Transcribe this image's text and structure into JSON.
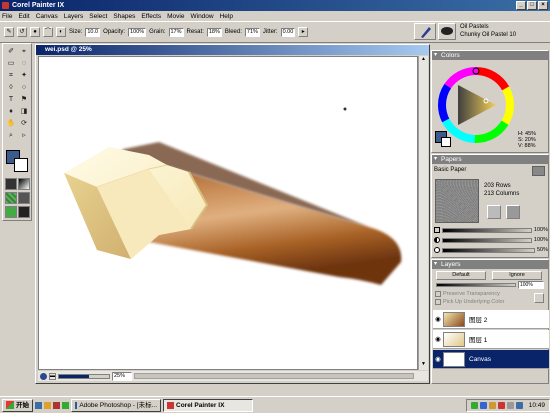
{
  "app": {
    "title": "Corel Painter IX",
    "window_buttons": [
      "_",
      "□",
      "×"
    ]
  },
  "menu": [
    "File",
    "Edit",
    "Canvas",
    "Layers",
    "Select",
    "Shapes",
    "Effects",
    "Movie",
    "Window",
    "Help"
  ],
  "property_bar": {
    "size_label": "Size:",
    "size_value": "10.0",
    "opacity_label": "Opacity:",
    "opacity_value": "100%",
    "grain_label": "Grain:",
    "grain_value": "17%",
    "resat_label": "Resat:",
    "resat_value": "18%",
    "bleed_label": "Bleed:",
    "bleed_value": "71%",
    "jitter_label": "Jitter:",
    "jitter_value": "0.00"
  },
  "brush_selector": {
    "category": "Oil Pastels",
    "variant": "Chunky Oil Pastel 10"
  },
  "document": {
    "title": "wei.psd @ 25%",
    "zoom": "25%"
  },
  "colors_panel": {
    "title": "Colors",
    "h": "H: 45%",
    "s": "S: 20%",
    "v": "V: 88%",
    "main_color": "#3c5a8c",
    "secondary_color": "#ffffff",
    "hue_indicator_color": "#f0d060"
  },
  "papers_panel": {
    "title": "Papers",
    "paper_name": "Basic Paper",
    "rows": "203 Rows",
    "columns": "213 Columns",
    "slider1_value": "100%",
    "slider2_value": "100%",
    "slider3_value": "50%"
  },
  "layers_panel": {
    "title": "Layers",
    "composite_method": "Default",
    "depth": "Ignore",
    "opacity_value": "100%",
    "preserve_transparency": "Preserve Transparency",
    "pick_up_color": "Pick Up Underlying Color",
    "layers": [
      {
        "name": "图层 2"
      },
      {
        "name": "图层 1"
      },
      {
        "name": "Canvas"
      }
    ]
  },
  "taskbar": {
    "start": "开始",
    "items": [
      {
        "label": "Adobe Photoshop - [未标..."
      },
      {
        "label": "Corel Painter IX"
      }
    ],
    "clock": "10:49"
  }
}
